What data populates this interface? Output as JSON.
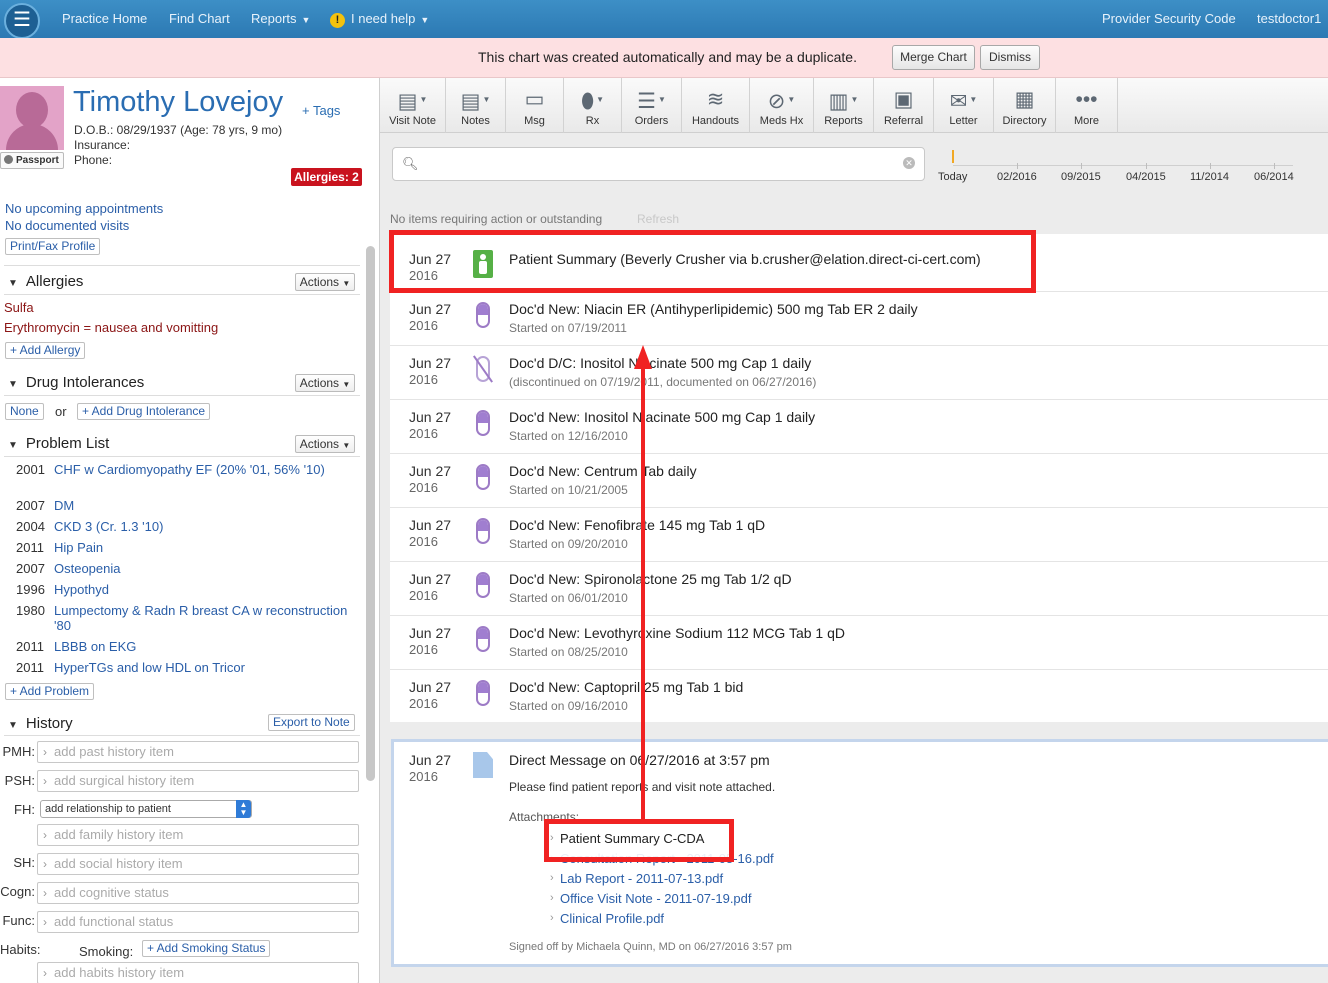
{
  "nav": {
    "items": [
      "Practice Home",
      "Find Chart",
      "Reports",
      "I need help"
    ],
    "right": [
      "Provider Security Code",
      "testdoctor1"
    ]
  },
  "banner": {
    "message": "This chart was created automatically and may be a duplicate.",
    "merge": "Merge Chart",
    "dismiss": "Dismiss"
  },
  "patient": {
    "name": "Timothy Lovejoy",
    "tags": "+ Tags",
    "dob": "D.O.B.: 08/29/1937 (Age: 78 yrs, 9 mo)",
    "insurance": "Insurance:",
    "phone": "Phone:",
    "passport": "Passport",
    "allergies_badge": "Allergies: 2"
  },
  "visits": {
    "appointments": "No upcoming appointments",
    "documented": "No documented visits",
    "print": "Print/Fax Profile"
  },
  "allergies": {
    "title": "Allergies",
    "actions": "Actions",
    "items": [
      "Sulfa",
      "Erythromycin = nausea and vomitting"
    ],
    "add": "+ Add Allergy"
  },
  "intolerances": {
    "title": "Drug Intolerances",
    "actions": "Actions",
    "none": "None",
    "or": "or",
    "add": "+ Add Drug Intolerance"
  },
  "problems": {
    "title": "Problem List",
    "actions": "Actions",
    "items": [
      {
        "year": "2001",
        "name": "CHF w Cardiomyopathy EF (20% '01, 56% '10)"
      },
      {
        "year": "2007",
        "name": "DM"
      },
      {
        "year": "2004",
        "name": "CKD 3 (Cr. 1.3 '10)"
      },
      {
        "year": "2011",
        "name": "Hip Pain"
      },
      {
        "year": "2007",
        "name": "Osteopenia"
      },
      {
        "year": "1996",
        "name": "Hypothyd"
      },
      {
        "year": "1980",
        "name": "Lumpectomy & Radn R breast CA w reconstruction",
        "name2": "'80"
      },
      {
        "year": "2011",
        "name": "LBBB on EKG"
      },
      {
        "year": "2011",
        "name": "HyperTGs and low HDL on Tricor"
      }
    ],
    "add": "+ Add Problem"
  },
  "history": {
    "title": "History",
    "export": "Export to Note",
    "pmh_label": "PMH:",
    "pmh": "add past history item",
    "psh_label": "PSH:",
    "psh": "add surgical history item",
    "fh_label": "FH:",
    "fh_select": "add relationship to patient",
    "fh": "add family history item",
    "sh_label": "SH:",
    "sh": "add social history item",
    "cogn_label": "Cogn:",
    "cogn": "add cognitive status",
    "func_label": "Func:",
    "func": "add functional status",
    "habits_label": "Habits:",
    "smoking": "Smoking:",
    "add_smoking": "+ Add Smoking Status",
    "habits": "add habits history item"
  },
  "toolbar": [
    "Visit Note",
    "Notes",
    "Msg",
    "Rx",
    "Orders",
    "Handouts",
    "Meds Hx",
    "Reports",
    "Referral",
    "Letter",
    "Directory",
    "More"
  ],
  "timeline": [
    "Today",
    "02/2016",
    "09/2015",
    "04/2015",
    "11/2014",
    "06/2014"
  ],
  "feed_status": {
    "none": "No items requiring action or outstanding",
    "refresh": "Refresh"
  },
  "feed": [
    {
      "date": "Jun 27",
      "year": "2016",
      "title": "Patient Summary (Beverly Crusher via b.crusher@elation.direct-ci-cert.com)",
      "sub": ""
    },
    {
      "date": "Jun 27",
      "year": "2016",
      "title": "Doc'd New: Niacin ER (Antihyperlipidemic) 500 mg Tab ER 2 daily",
      "sub": "Started on 07/19/2011"
    },
    {
      "date": "Jun 27",
      "year": "2016",
      "title": "Doc'd D/C: Inositol Niacinate 500 mg Cap 1 daily",
      "sub": "(discontinued on 07/19/2011, documented on 06/27/2016)"
    },
    {
      "date": "Jun 27",
      "year": "2016",
      "title": "Doc'd New: Inositol Niacinate 500 mg Cap 1 daily",
      "sub": "Started on 12/16/2010"
    },
    {
      "date": "Jun 27",
      "year": "2016",
      "title": "Doc'd New: Centrum Tab daily",
      "sub": "Started on 10/21/2005"
    },
    {
      "date": "Jun 27",
      "year": "2016",
      "title": "Doc'd New: Fenofibrate 145 mg Tab 1 qD",
      "sub": "Started on 09/20/2010"
    },
    {
      "date": "Jun 27",
      "year": "2016",
      "title": "Doc'd New: Spironolactone 25 mg Tab 1/2 qD",
      "sub": "Started on 06/01/2010"
    },
    {
      "date": "Jun 27",
      "year": "2016",
      "title": "Doc'd New: Levothyroxine Sodium 112 MCG Tab 1 qD",
      "sub": "Started on 08/25/2010"
    },
    {
      "date": "Jun 27",
      "year": "2016",
      "title": "Doc'd New: Captopril 25 mg Tab 1 bid",
      "sub": "Started on 09/16/2010"
    }
  ],
  "message": {
    "date": "Jun 27",
    "year": "2016",
    "title": "Direct Message on 06/27/2016 at 3:57 pm",
    "body": "Please find patient reports and visit note attached.",
    "attachments_label": "Attachments:",
    "attachments": [
      "Patient Summary C-CDA",
      "Consultation Report - 2011-05-16.pdf",
      "Lab Report - 2011-07-13.pdf",
      "Office Visit Note - 2011-07-19.pdf",
      "Clinical Profile.pdf"
    ],
    "signed": "Signed off by Michaela Quinn, MD on 06/27/2016 3:57 pm"
  },
  "colors": {
    "nav": "#2c79b3",
    "banner": "#fde0e2",
    "annotation": "#f02222",
    "allergy_badge": "#c9131e"
  }
}
